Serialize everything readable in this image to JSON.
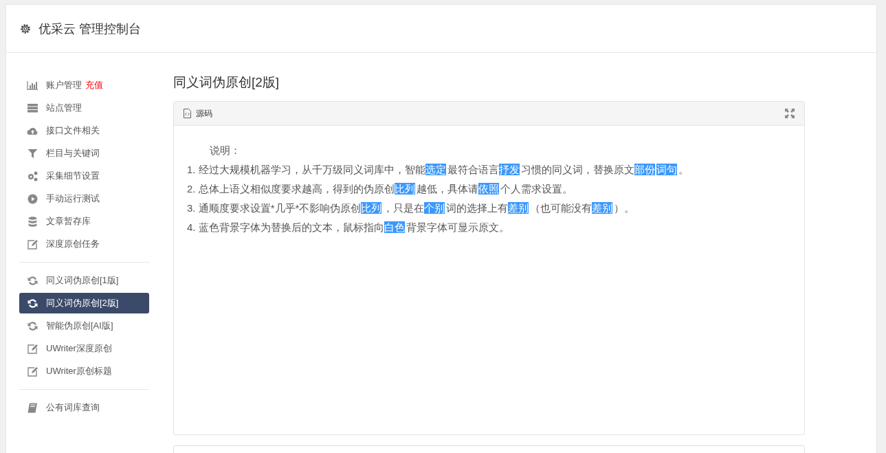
{
  "header": {
    "title": "优采云 管理控制台"
  },
  "sidebar": {
    "groups": [
      {
        "items": [
          {
            "label": "账户管理",
            "badge": "充值",
            "selected": false
          },
          {
            "label": "站点管理",
            "selected": false
          },
          {
            "label": "接口文件相关",
            "selected": false
          },
          {
            "label": "栏目与关键词",
            "selected": false
          },
          {
            "label": "采集细节设置",
            "selected": false
          },
          {
            "label": "手动运行测试",
            "selected": false
          },
          {
            "label": "文章暂存库",
            "selected": false
          },
          {
            "label": "深度原创任务",
            "selected": false
          }
        ]
      },
      {
        "items": [
          {
            "label": "同义词伪原创[1版]",
            "selected": false
          },
          {
            "label": "同义词伪原创[2版]",
            "selected": true
          },
          {
            "label": "智能伪原创[AI版]",
            "selected": false
          },
          {
            "label": "UWriter深度原创",
            "selected": false
          },
          {
            "label": "UWriter原创标题",
            "selected": false
          }
        ]
      },
      {
        "items": [
          {
            "label": "公有词库查询",
            "selected": false
          }
        ]
      }
    ]
  },
  "content": {
    "title": "同义词伪原创[2版]",
    "panel": {
      "title": "源码",
      "heading": "说明：",
      "lines": [
        [
          {
            "text": "1. 经过大规模机器学习，从千万级同义词库中，智能",
            "highlight": false
          },
          {
            "text": "选定",
            "highlight": true
          },
          {
            "text": "最符合语言",
            "highlight": false
          },
          {
            "text": "抒发",
            "highlight": true
          },
          {
            "text": "习惯的同义词，替换原文",
            "highlight": false
          },
          {
            "text": "部份",
            "highlight": true
          },
          {
            "text": "词句",
            "highlight": true
          },
          {
            "text": "。",
            "highlight": false
          }
        ],
        [
          {
            "text": "2. 总体上语义相似度要求越高，得到的伪原创",
            "highlight": false
          },
          {
            "text": "比列",
            "highlight": true
          },
          {
            "text": "越低，具体请",
            "highlight": false
          },
          {
            "text": "依照",
            "highlight": true
          },
          {
            "text": "个人需求设置。",
            "highlight": false
          }
        ],
        [
          {
            "text": "3. 通顺度要求设置*几乎*不影响伪原创",
            "highlight": false
          },
          {
            "text": "比列",
            "highlight": true
          },
          {
            "text": "，只是在",
            "highlight": false
          },
          {
            "text": "个别",
            "highlight": true
          },
          {
            "text": "词的选择上有",
            "highlight": false
          },
          {
            "text": "差别",
            "highlight": true
          },
          {
            "text": "（也可能没有",
            "highlight": false
          },
          {
            "text": "差别",
            "highlight": true
          },
          {
            "text": "）。",
            "highlight": false
          }
        ],
        [
          {
            "text": "4. 蓝色背景字体为替换后的文本，鼠标指向",
            "highlight": false
          },
          {
            "text": "白色",
            "highlight": true
          },
          {
            "text": "背景字体可显示原文。",
            "highlight": false
          }
        ]
      ]
    }
  }
}
